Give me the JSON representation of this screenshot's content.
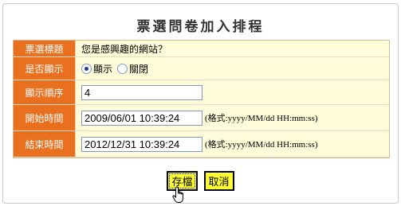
{
  "title": "票選問卷加入排程",
  "rows": [
    {
      "label": "票選標題",
      "value": "您是感興趣的網站？"
    },
    {
      "label": "是否顯示",
      "options": [
        "顯示",
        "關閉"
      ],
      "selected": "顯示"
    },
    {
      "label": "顯示順序",
      "value": "4"
    },
    {
      "label": "開始時間",
      "value": "2009/06/01 10:39:24",
      "hint": "(格式:yyyy/MM/dd HH:mm:ss)"
    },
    {
      "label": "結束時間",
      "value": "2012/12/31 10:39:24",
      "hint": "(格式:yyyy/MM/dd HH:mm:ss)"
    }
  ],
  "buttons": {
    "save": "存檔",
    "cancel": "取消"
  },
  "colors": {
    "label_bg": "#e8701e",
    "value_bg": "#fffcd9",
    "button_bg": "#ffff33"
  },
  "icons": {
    "cursor": "hand-pointer-icon"
  }
}
